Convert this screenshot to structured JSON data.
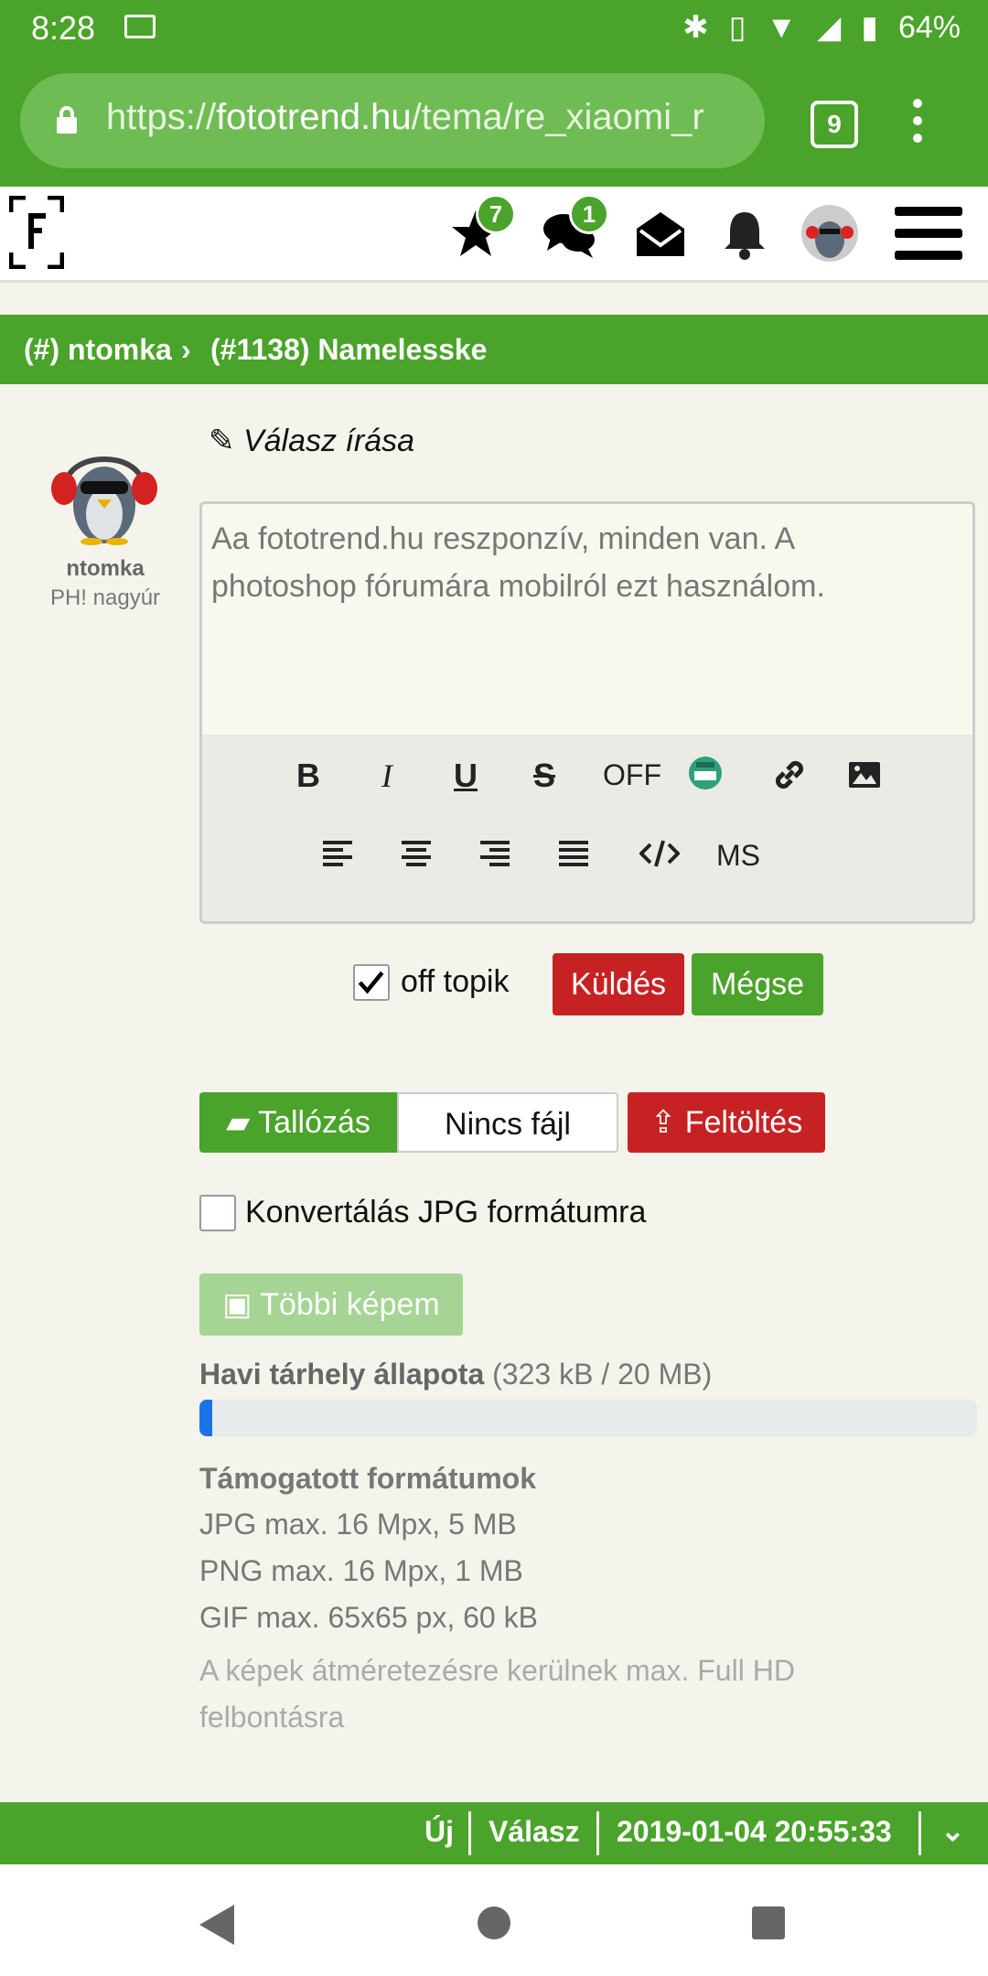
{
  "status_bar": {
    "time": "8:28",
    "battery": "64%"
  },
  "browser": {
    "url_prefix": "https://",
    "url_domain": "fototrend.hu",
    "url_path": "/tema/re_xiaomi_r",
    "tab_count": "9"
  },
  "site_header": {
    "favorites_badge": "7",
    "messages_badge": "1"
  },
  "breadcrumb": {
    "author": "(#) ntomka",
    "target": "(#1138) Namelesske"
  },
  "user": {
    "name": "ntomka",
    "rank": "PH! nagyúr"
  },
  "reply": {
    "title": "Válasz írása",
    "text": "Aa fototrend.hu reszponzív, minden van. A photoshop fórumára mobilról ezt használom."
  },
  "toolbar": {
    "bold": "B",
    "italic": "I",
    "underline": "U",
    "strike": "S",
    "off": "OFF",
    "ms": "MS"
  },
  "form": {
    "offtopic_label": "off topik",
    "offtopic_checked": true,
    "send_label": "Küldés",
    "cancel_label": "Mégse",
    "browse_label": "Tallózás",
    "no_file_label": "Nincs fájl",
    "upload_label": "Feltöltés",
    "convert_label": "Konvertálás JPG formátumra",
    "convert_checked": false,
    "more_images_label": "Többi képem"
  },
  "storage": {
    "label": "Havi tárhely állapota",
    "value": "(323 kB / 20 MB)",
    "fraction_used": 0.016
  },
  "formats": {
    "title": "Támogatott formátumok",
    "lines": [
      "JPG max. 16 Mpx, 5 MB",
      "PNG max. 16 Mpx, 1 MB",
      "GIF max. 65x65 px, 60 kB"
    ],
    "note": "A képek átméretezésre kerülnek max. Full HD felbontásra"
  },
  "bottom_bar": {
    "new_label": "Új",
    "reply_label": "Válasz",
    "timestamp": "2019-01-04 20:55:33"
  },
  "colors": {
    "brand_green": "#4aa32a",
    "danger_red": "#c62224",
    "progress_blue": "#1a74e8"
  }
}
